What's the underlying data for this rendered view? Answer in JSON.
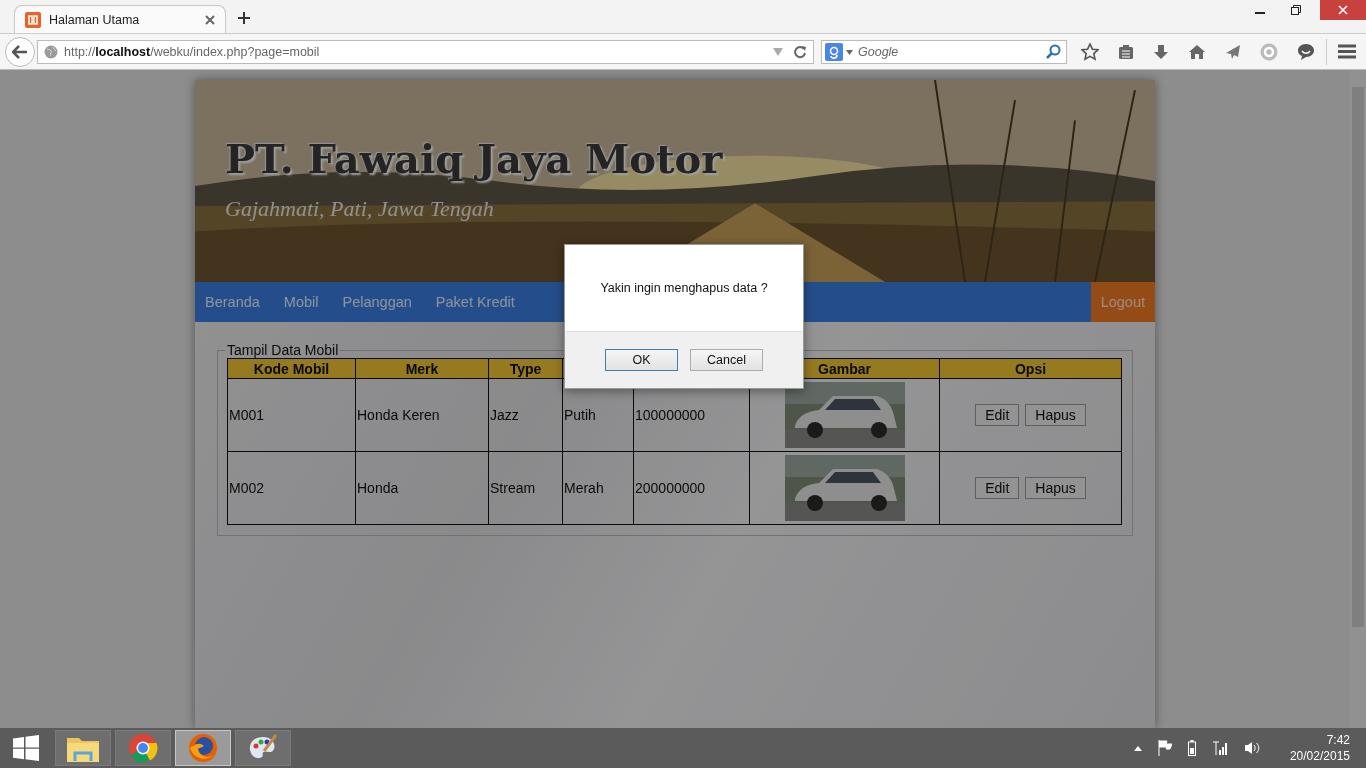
{
  "browser": {
    "tab": {
      "title": "Halaman Utama"
    },
    "url": {
      "scheme": "http://",
      "host": "localhost",
      "path": "/webku/index.php?page=mobil"
    },
    "search": {
      "placeholder": "Google"
    }
  },
  "site": {
    "title": "PT. Fawaiq Jaya Motor",
    "subtitle": "Gajahmati, Pati, Jawa Tengah",
    "nav": [
      {
        "label": "Beranda"
      },
      {
        "label": "Mobil"
      },
      {
        "label": "Pelanggan"
      },
      {
        "label": "Paket Kredit"
      }
    ],
    "logout": "Logout"
  },
  "panel": {
    "legend": "Tampil Data Mobil",
    "columns_left": [
      "Kode Mobil",
      "Merk",
      "Type"
    ],
    "columns_right": [
      "Gambar",
      "Opsi"
    ],
    "rows": [
      {
        "kode": "M001",
        "merk": "Honda Keren",
        "type": "Jazz",
        "column_4": "Putih",
        "column_5": "100000000",
        "gambar": {
          "kind": "picture"
        },
        "actions": [
          "Edit",
          "Hapus"
        ]
      },
      {
        "kode": "M002",
        "merk": "Honda",
        "type": "Stream",
        "column_4": "Merah",
        "column_5": "200000000",
        "gambar": {
          "kind": "picture"
        },
        "actions": [
          "Edit",
          "Hapus"
        ]
      }
    ]
  },
  "dialog": {
    "message": "Yakin ingin menghapus data ?",
    "buttons": [
      {
        "label": "OK",
        "selected": true
      },
      {
        "label": "Cancel",
        "selected": false
      }
    ]
  },
  "taskbar": {
    "apps": [
      {
        "kind": "folder",
        "selected": false
      },
      {
        "kind": "chrome",
        "selected": false
      },
      {
        "kind": "firefox",
        "selected": true
      },
      {
        "kind": "paint",
        "selected": false
      }
    ],
    "time": "7:42",
    "date": "20/02/2015"
  }
}
